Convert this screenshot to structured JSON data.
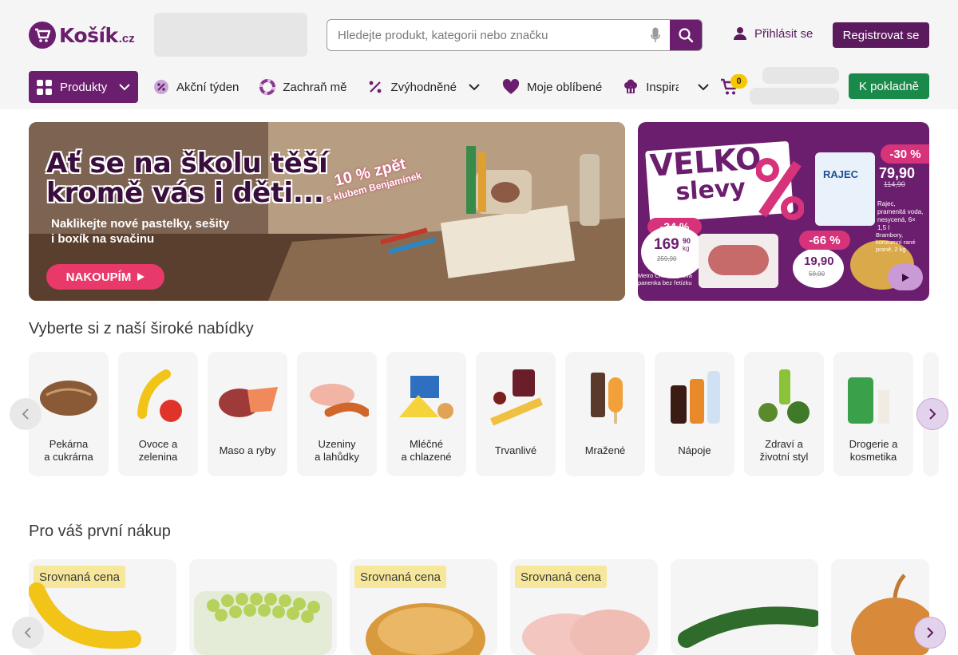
{
  "header": {
    "logo_text": "Košík",
    "logo_tld": ".cz",
    "search_placeholder": "Hledejte produkt, kategorii nebo značku",
    "login_label": "Přihlásit se",
    "register_label": "Registrovat se",
    "cart_count": "0",
    "checkout_label": "K pokladně"
  },
  "nav": {
    "products": "Produkty",
    "items": [
      "Akční týden",
      "Zachraň mě",
      "Zvýhodněné",
      "Moje oblíbené",
      "Inspira"
    ]
  },
  "banner_main": {
    "title_line1": "Ať se na školu těší",
    "title_line2": "kromě vás i děti...",
    "subtitle_line1": "Naklikejte nové pastelky, sešity",
    "subtitle_line2": "i boxík na svačinu",
    "cta": "NAKOUPÍM",
    "promo_line1": "10 % zpět",
    "promo_line2": "s klubem Benjamínek"
  },
  "banner_side": {
    "title_line1": "VELKO",
    "title_line2": "slevy",
    "offer1_discount": "-30 %",
    "offer1_price": "79,90",
    "offer1_old": "114,90",
    "offer1_desc": "Rajec, pramenitá voda, nesycená, 6× 1,5 l",
    "offer1_brand": "RAJEC",
    "offer2_discount": "-34 %",
    "offer2_price": "169",
    "offer2_cents": "90",
    "offer2_unit": "kg",
    "offer2_old": "259,90",
    "offer2_desc": "Metro Chef, vepřová panenka bez řetízku",
    "offer3_discount": "-66 %",
    "offer3_price": "19,90",
    "offer3_old": "59,90",
    "offer3_desc": "Brambory, konzumní rané praně, 2 kg"
  },
  "categories_title": "Vyberte si z naší široké nabídky",
  "categories": [
    {
      "l1": "Pekárna",
      "l2": "a cukrárna"
    },
    {
      "l1": "Ovoce a",
      "l2": "zelenina"
    },
    {
      "l1": "Maso a ryby",
      "l2": ""
    },
    {
      "l1": "Uzeniny",
      "l2": "a lahůdky"
    },
    {
      "l1": "Mléčné",
      "l2": "a chlazené"
    },
    {
      "l1": "Trvanlivé",
      "l2": ""
    },
    {
      "l1": "Mražené",
      "l2": ""
    },
    {
      "l1": "Nápoje",
      "l2": ""
    },
    {
      "l1": "Zdraví a",
      "l2": "životní styl"
    },
    {
      "l1": "Drogerie a",
      "l2": "kosmetika"
    }
  ],
  "first_purchase_title": "Pro váš první nákup",
  "products_badge": "Srovnaná cena",
  "colors": {
    "brand": "#6b1d6e",
    "checkout": "#1a8a4a",
    "badge": "#f6e79a",
    "cart_badge": "#f7c600"
  }
}
